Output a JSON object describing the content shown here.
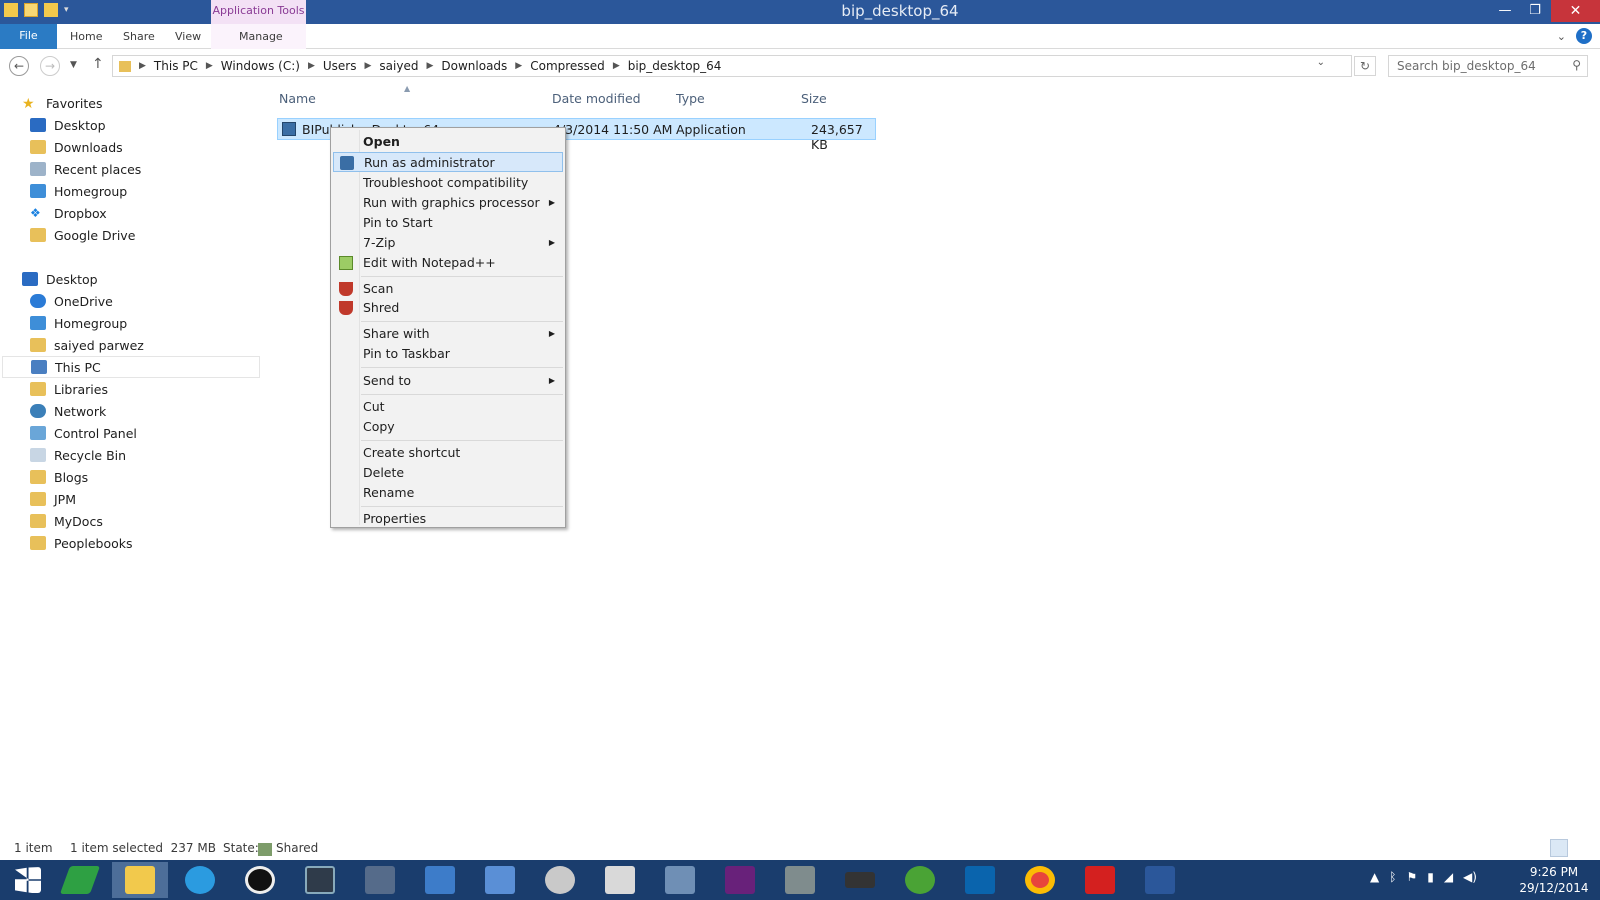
{
  "window": {
    "title": "bip_desktop_64",
    "context_tab": "Application Tools",
    "minimize": "—",
    "maximize": "❐",
    "close": "✕"
  },
  "ribbon": {
    "file": "File",
    "tabs": [
      "Home",
      "Share",
      "View"
    ],
    "manage": "Manage",
    "help": "?"
  },
  "address": {
    "crumbs": [
      "This PC",
      "Windows (C:)",
      "Users",
      "saiyed",
      "Downloads",
      "Compressed",
      "bip_desktop_64"
    ],
    "separator": "▶",
    "search_placeholder": "Search bip_desktop_64"
  },
  "nav": {
    "favorites_header": "Favorites",
    "favorites": [
      "Desktop",
      "Downloads",
      "Recent places",
      "Homegroup",
      "Dropbox",
      "Google Drive"
    ],
    "desktop_header": "Desktop",
    "desktop_items": [
      "OneDrive",
      "Homegroup",
      "saiyed parwez",
      "This PC",
      "Libraries",
      "Network",
      "Control Panel",
      "Recycle Bin",
      "Blogs",
      "JPM",
      "MyDocs",
      "Peoplebooks"
    ]
  },
  "columns": {
    "name": "Name",
    "date": "Date modified",
    "type": "Type",
    "size": "Size"
  },
  "file": {
    "name": "BIPublisherDesktop64",
    "name_visible": "BIPub",
    "date": "4/3/2014 11:50 AM",
    "date_visible": "4/3/2014 11:50 AM",
    "type": "Application",
    "size": "243,657 KB"
  },
  "context_menu": {
    "open": "Open",
    "run_as_admin": "Run as administrator",
    "troubleshoot": "Troubleshoot compatibility",
    "run_gpu": "Run with graphics processor",
    "pin_start": "Pin to Start",
    "seven_zip": "7-Zip",
    "edit_notepad": "Edit with Notepad++",
    "scan": "Scan",
    "shred": "Shred",
    "share_with": "Share with",
    "pin_taskbar": "Pin to Taskbar",
    "send_to": "Send to",
    "cut": "Cut",
    "copy": "Copy",
    "create_shortcut": "Create shortcut",
    "delete": "Delete",
    "rename": "Rename",
    "properties": "Properties"
  },
  "status": {
    "items": "1 item",
    "selected": "1 item selected  237 MB",
    "state_label": "State:",
    "state_value": "Shared"
  },
  "clock": {
    "time": "9:26 PM",
    "date": "29/12/2014"
  },
  "colors": {
    "titlebar": "#2b579a",
    "file_tab": "#2b7bc4",
    "selection": "#cce8ff",
    "taskbar": "#1a3d6d",
    "close": "#c7343b"
  }
}
